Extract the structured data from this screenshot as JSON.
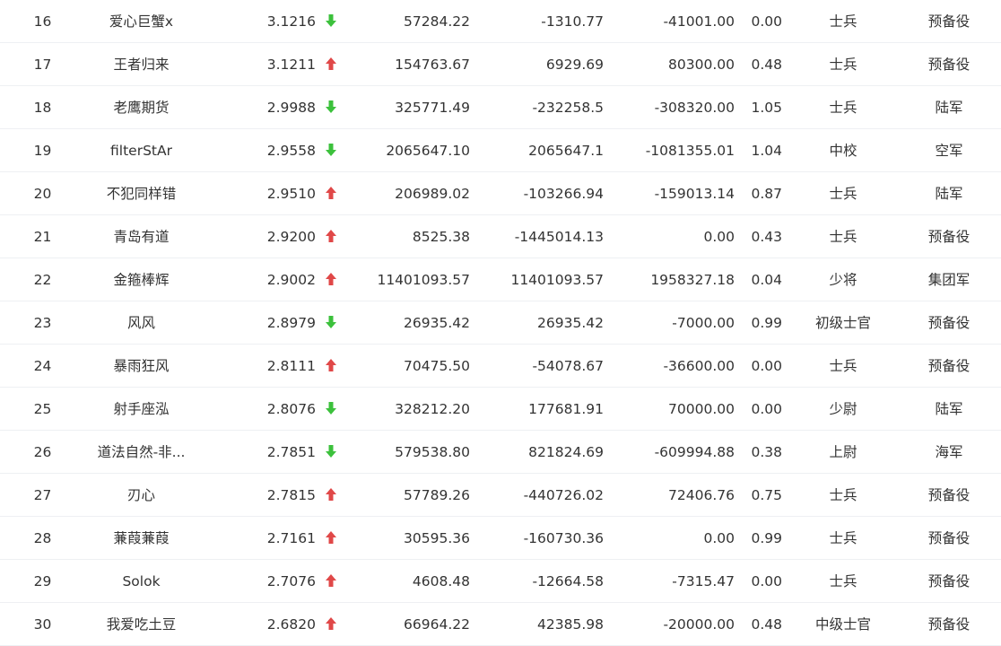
{
  "colors": {
    "up": "#e04848",
    "down": "#3cc13c"
  },
  "rows": [
    {
      "rank": "16",
      "name": "爱心巨蟹x",
      "score": "3.1216",
      "trend": "down",
      "v1": "57284.22",
      "v2": "-1310.77",
      "v3": "-41001.00",
      "v4": "0.00",
      "title": "士兵",
      "branch": "预备役"
    },
    {
      "rank": "17",
      "name": "王者归来",
      "score": "3.1211",
      "trend": "up",
      "v1": "154763.67",
      "v2": "6929.69",
      "v3": "80300.00",
      "v4": "0.48",
      "title": "士兵",
      "branch": "预备役"
    },
    {
      "rank": "18",
      "name": "老鹰期货",
      "score": "2.9988",
      "trend": "down",
      "v1": "325771.49",
      "v2": "-232258.5",
      "v3": "-308320.00",
      "v4": "1.05",
      "title": "士兵",
      "branch": "陆军"
    },
    {
      "rank": "19",
      "name": "filterStAr",
      "score": "2.9558",
      "trend": "down",
      "v1": "2065647.10",
      "v2": "2065647.1",
      "v3": "-1081355.01",
      "v4": "1.04",
      "title": "中校",
      "branch": "空军"
    },
    {
      "rank": "20",
      "name": "不犯同样错",
      "score": "2.9510",
      "trend": "up",
      "v1": "206989.02",
      "v2": "-103266.94",
      "v3": "-159013.14",
      "v4": "0.87",
      "title": "士兵",
      "branch": "陆军"
    },
    {
      "rank": "21",
      "name": "青岛有道",
      "score": "2.9200",
      "trend": "up",
      "v1": "8525.38",
      "v2": "-1445014.13",
      "v3": "0.00",
      "v4": "0.43",
      "title": "士兵",
      "branch": "预备役"
    },
    {
      "rank": "22",
      "name": "金箍棒辉",
      "score": "2.9002",
      "trend": "up",
      "v1": "11401093.57",
      "v2": "11401093.57",
      "v3": "1958327.18",
      "v4": "0.04",
      "title": "少将",
      "branch": "集团军"
    },
    {
      "rank": "23",
      "name": "风风",
      "score": "2.8979",
      "trend": "down",
      "v1": "26935.42",
      "v2": "26935.42",
      "v3": "-7000.00",
      "v4": "0.99",
      "title": "初级士官",
      "branch": "预备役"
    },
    {
      "rank": "24",
      "name": "暴雨狂风",
      "score": "2.8111",
      "trend": "up",
      "v1": "70475.50",
      "v2": "-54078.67",
      "v3": "-36600.00",
      "v4": "0.00",
      "title": "士兵",
      "branch": "预备役"
    },
    {
      "rank": "25",
      "name": "射手座泓",
      "score": "2.8076",
      "trend": "down",
      "v1": "328212.20",
      "v2": "177681.91",
      "v3": "70000.00",
      "v4": "0.00",
      "title": "少尉",
      "branch": "陆军"
    },
    {
      "rank": "26",
      "name": "道法自然-非...",
      "score": "2.7851",
      "trend": "down",
      "v1": "579538.80",
      "v2": "821824.69",
      "v3": "-609994.88",
      "v4": "0.38",
      "title": "上尉",
      "branch": "海军"
    },
    {
      "rank": "27",
      "name": "刃心",
      "score": "2.7815",
      "trend": "up",
      "v1": "57789.26",
      "v2": "-440726.02",
      "v3": "72406.76",
      "v4": "0.75",
      "title": "士兵",
      "branch": "预备役"
    },
    {
      "rank": "28",
      "name": "蒹葭蒹葭",
      "score": "2.7161",
      "trend": "up",
      "v1": "30595.36",
      "v2": "-160730.36",
      "v3": "0.00",
      "v4": "0.99",
      "title": "士兵",
      "branch": "预备役"
    },
    {
      "rank": "29",
      "name": "Solok",
      "score": "2.7076",
      "trend": "up",
      "v1": "4608.48",
      "v2": "-12664.58",
      "v3": "-7315.47",
      "v4": "0.00",
      "title": "士兵",
      "branch": "预备役"
    },
    {
      "rank": "30",
      "name": "我爱吃土豆",
      "score": "2.6820",
      "trend": "up",
      "v1": "66964.22",
      "v2": "42385.98",
      "v3": "-20000.00",
      "v4": "0.48",
      "title": "中级士官",
      "branch": "预备役"
    }
  ]
}
